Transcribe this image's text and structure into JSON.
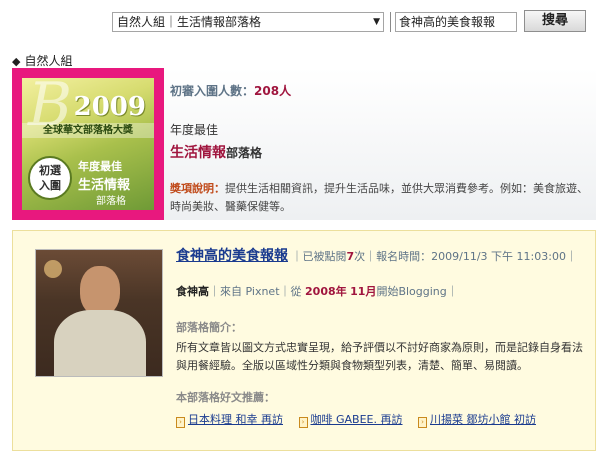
{
  "search": {
    "category_value": "自然人組｜生活情報部落格",
    "query_value": "食神高的美食報報",
    "button_label": "搜尋"
  },
  "section": {
    "label": "自然人組"
  },
  "award": {
    "badge": {
      "letter": "B",
      "year": "2009",
      "title": "全球華文部落格大獎",
      "seal": [
        "初選",
        "入圍"
      ],
      "year_best": "年度最佳",
      "category": "生活情報",
      "sub": "部落格"
    },
    "count_label": "初審入圍人數：",
    "count_value": "208人",
    "year_best": "年度最佳",
    "category": "生活情報",
    "category_suffix": "部落格",
    "desc_label": "獎項說明：",
    "desc_text": "提供生活相關資訊，提升生活品味，並供大眾消費參考。例如：美食旅遊、時尚美妝、醫藥保健等。"
  },
  "blog": {
    "title": "食神高的美食報報",
    "clicks_label": "｜已被點閱",
    "clicks_value": "7",
    "clicks_unit": "次",
    "reg_label": "｜報名時間：",
    "reg_time": "2009/11/3 下午 11:03:00",
    "reg_end": "｜",
    "author": "食神高",
    "from": "｜來自 Pixnet｜從",
    "start_year": "2008年",
    "start_month": "11月",
    "start_suffix": "開始Blogging｜",
    "intro_label": "部落格簡介：",
    "intro_text": "所有文章皆以圖文方式忠實呈現，給予評價以不討好商家為原則，而是記錄自身看法與用餐經驗。全版以區域性分類與食物類型列表，清楚、簡單、易閱讀。",
    "recommend_label": "本部落格好文推薦：",
    "recommendations": [
      "日本料理 和幸 再訪",
      "咖啡 GABEE. 再訪",
      "川揚菜 鄒坊小館 初訪"
    ]
  }
}
